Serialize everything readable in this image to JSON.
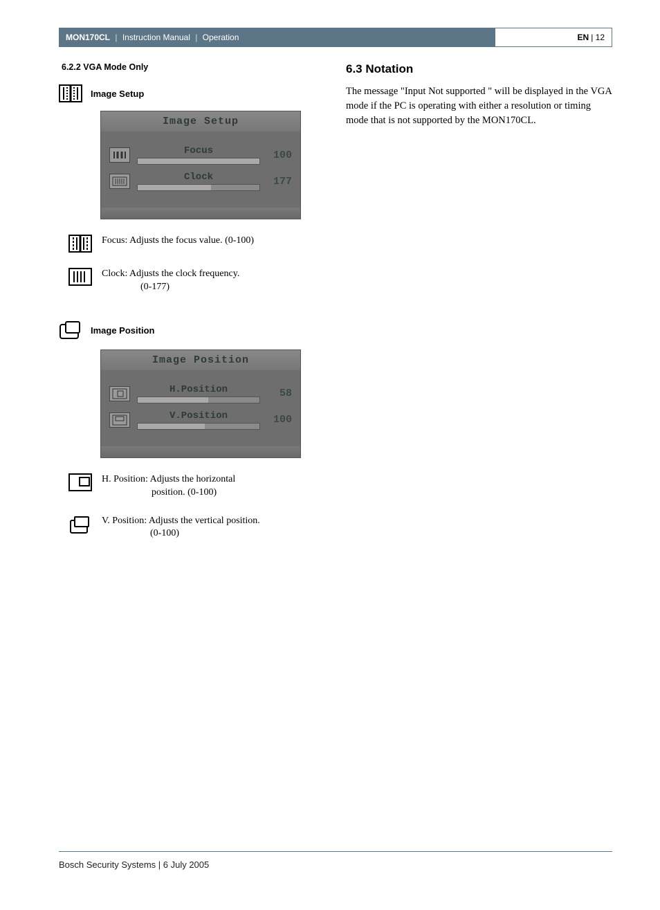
{
  "header": {
    "product": "MON170CL",
    "doc": "Instruction Manual",
    "section": "Operation",
    "lang": "EN",
    "page": "12"
  },
  "left": {
    "sect_num": "6.2.2 VGA Mode Only",
    "image_setup_title": "Image Setup",
    "osd1": {
      "title": "Image Setup",
      "rows": [
        {
          "label": "Focus",
          "value": "100",
          "fill": 100
        },
        {
          "label": "Clock",
          "value": "177",
          "fill": 60
        }
      ]
    },
    "focus_desc": "Focus: Adjusts the focus value. (0-100)",
    "clock_desc": "Clock: Adjusts the clock frequency.",
    "clock_range": "(0-177)",
    "image_position_title": "Image Position",
    "osd2": {
      "title": "Image Position",
      "rows": [
        {
          "label": "H.Position",
          "value": "58",
          "fill": 58
        },
        {
          "label": "V.Position",
          "value": "100",
          "fill": 55
        }
      ]
    },
    "hpos_desc": "H. Position: Adjusts the horizontal",
    "hpos_desc2": "position. (0-100)",
    "vpos_desc": "V. Position: Adjusts the vertical position.",
    "vpos_range": "(0-100)"
  },
  "right": {
    "heading": "6.3 Notation",
    "body": "The message \"Input Not supported \" will be displayed in the VGA mode if the PC is operating with either a resolution or timing mode that is not supported by the MON170CL."
  },
  "footer": "Bosch Security Systems | 6 July 2005",
  "chart_data": [
    {
      "type": "bar",
      "title": "Image Setup",
      "series": [
        {
          "name": "Focus",
          "values": [
            100
          ],
          "range": [
            0,
            100
          ]
        },
        {
          "name": "Clock",
          "values": [
            177
          ],
          "range": [
            0,
            177
          ]
        }
      ]
    },
    {
      "type": "bar",
      "title": "Image Position",
      "series": [
        {
          "name": "H.Position",
          "values": [
            58
          ],
          "range": [
            0,
            100
          ]
        },
        {
          "name": "V.Position",
          "values": [
            100
          ],
          "range": [
            0,
            100
          ]
        }
      ]
    }
  ]
}
